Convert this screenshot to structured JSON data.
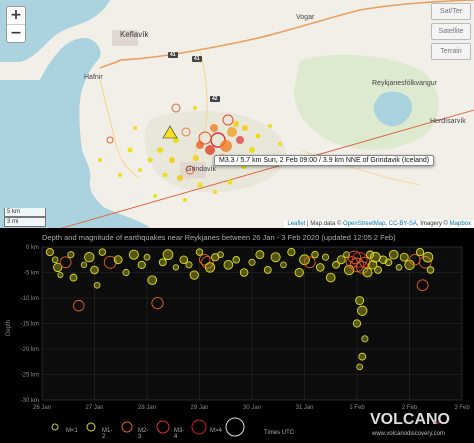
{
  "map": {
    "zoom_in": "+",
    "zoom_out": "−",
    "layer_buttons": [
      "Sat/Ter",
      "Satellite",
      "Terrain"
    ],
    "scale_km": "5 km",
    "scale_mi": "3 mi",
    "tooltip": "M3.3 / 5.7 km Sun, 2 Feb 09:00 / 3.9 km NNE of Grindavik (Iceland)",
    "attribution": {
      "leaflet": "Leaflet",
      "sep1": " | Map data © ",
      "osm": "OpenStreetMap",
      "sep2": ", ",
      "license": "CC-BY-SA",
      "sep3": ", Imagery © ",
      "mapbox": "Mapbox"
    },
    "places": {
      "keflavik": "Keflavík",
      "hafnir": "Hafnir",
      "grindavik": "Grindavík",
      "reykjavik_region": "Reykjanesfólkvangur",
      "herdisarvik": "Herdísarvík",
      "vogar": "Vogar"
    },
    "road_numbers": [
      "41",
      "41",
      "42"
    ]
  },
  "chart": {
    "title": "Depth and magnitude of earthquakes near Reykjanes between 26 Jan - 3 Feb 2020 (updated 12:05 2 Feb)",
    "legend": [
      {
        "label": "M<1",
        "color": "#cccc33"
      },
      {
        "label": "M1-2",
        "color": "#dddd22"
      },
      {
        "label": "M2-3",
        "color": "#e06020"
      },
      {
        "label": "M3-4",
        "color": "#e03030"
      },
      {
        "label": "M>4",
        "color": "#cc2222"
      },
      {
        "label": "",
        "color": "#dddddd"
      }
    ],
    "times_label": "Times UTC",
    "logo_main": "VOLCANO",
    "logo_sub": "www.volcanodiscovery.com",
    "logo_ornament": "~"
  },
  "chart_data": {
    "type": "scatter",
    "title": "Depth and magnitude of earthquakes near Reykjanes between 26 Jan - 3 Feb 2020 (updated 12:05 2 Feb)",
    "ylabel": "Depth",
    "ylim": [
      -30,
      0
    ],
    "y_ticks": [
      "0 km",
      "-5 km",
      "-10 km",
      "-15 km",
      "-20 km",
      "-25 km",
      "-30 km"
    ],
    "x_ticks": [
      "26 Jan",
      "27 Jan",
      "28 Jan",
      "29 Jan",
      "30 Jan",
      "31 Jan",
      "1 Feb",
      "2 Feb",
      "3 Feb"
    ],
    "xlim": [
      0,
      8
    ],
    "y_tick_values": [
      0,
      -5,
      -10,
      -15,
      -20,
      -25,
      -30
    ],
    "x_tick_values": [
      0,
      1,
      2,
      3,
      4,
      5,
      6,
      7,
      8
    ],
    "colors": {
      "M<1": "#cccc33",
      "M1-2": "#dddd22",
      "M2-3": "#e06020",
      "M3-4": "#e03030"
    },
    "points": [
      {
        "day": 0.15,
        "depth": -1.0,
        "mag": 1.2
      },
      {
        "day": 0.25,
        "depth": -2.5,
        "mag": 0.8
      },
      {
        "day": 0.3,
        "depth": -4.0,
        "mag": 1.5
      },
      {
        "day": 0.35,
        "depth": -5.5,
        "mag": 0.6
      },
      {
        "day": 0.45,
        "depth": -3.0,
        "mag": 2.2
      },
      {
        "day": 0.55,
        "depth": -1.5,
        "mag": 0.9
      },
      {
        "day": 0.6,
        "depth": -6.0,
        "mag": 1.1
      },
      {
        "day": 0.7,
        "depth": -11.5,
        "mag": 2.1
      },
      {
        "day": 0.8,
        "depth": -3.5,
        "mag": 0.7
      },
      {
        "day": 0.9,
        "depth": -2.0,
        "mag": 1.8
      },
      {
        "day": 1.0,
        "depth": -4.5,
        "mag": 1.3
      },
      {
        "day": 1.05,
        "depth": -7.5,
        "mag": 0.8
      },
      {
        "day": 1.15,
        "depth": -1.0,
        "mag": 1.0
      },
      {
        "day": 1.3,
        "depth": -3.0,
        "mag": 2.5
      },
      {
        "day": 1.45,
        "depth": -2.5,
        "mag": 1.4
      },
      {
        "day": 1.6,
        "depth": -5.0,
        "mag": 0.9
      },
      {
        "day": 1.75,
        "depth": -1.5,
        "mag": 1.7
      },
      {
        "day": 1.9,
        "depth": -3.5,
        "mag": 1.2
      },
      {
        "day": 2.0,
        "depth": -2.0,
        "mag": 0.8
      },
      {
        "day": 2.1,
        "depth": -6.5,
        "mag": 1.6
      },
      {
        "day": 2.2,
        "depth": -11.0,
        "mag": 2.3
      },
      {
        "day": 2.3,
        "depth": -3.0,
        "mag": 1.1
      },
      {
        "day": 2.4,
        "depth": -1.5,
        "mag": 1.9
      },
      {
        "day": 2.55,
        "depth": -4.0,
        "mag": 0.7
      },
      {
        "day": 2.7,
        "depth": -2.5,
        "mag": 1.3
      },
      {
        "day": 2.8,
        "depth": -3.5,
        "mag": 0.9
      },
      {
        "day": 2.9,
        "depth": -5.5,
        "mag": 1.5
      },
      {
        "day": 3.0,
        "depth": -1.0,
        "mag": 1.0
      },
      {
        "day": 3.1,
        "depth": -2.5,
        "mag": 2.1
      },
      {
        "day": 3.15,
        "depth": -3.0,
        "mag": 2.4
      },
      {
        "day": 3.2,
        "depth": -4.0,
        "mag": 1.8
      },
      {
        "day": 3.3,
        "depth": -2.0,
        "mag": 1.2
      },
      {
        "day": 3.4,
        "depth": -1.5,
        "mag": 0.8
      },
      {
        "day": 3.55,
        "depth": -3.5,
        "mag": 1.6
      },
      {
        "day": 3.7,
        "depth": -2.5,
        "mag": 1.0
      },
      {
        "day": 3.85,
        "depth": -5.0,
        "mag": 1.3
      },
      {
        "day": 4.0,
        "depth": -3.0,
        "mag": 0.9
      },
      {
        "day": 4.15,
        "depth": -1.5,
        "mag": 1.4
      },
      {
        "day": 4.3,
        "depth": -4.5,
        "mag": 1.1
      },
      {
        "day": 4.45,
        "depth": -2.0,
        "mag": 1.7
      },
      {
        "day": 4.6,
        "depth": -3.5,
        "mag": 0.8
      },
      {
        "day": 4.75,
        "depth": -1.0,
        "mag": 1.2
      },
      {
        "day": 4.9,
        "depth": -5.0,
        "mag": 1.5
      },
      {
        "day": 5.0,
        "depth": -2.5,
        "mag": 1.9
      },
      {
        "day": 5.1,
        "depth": -3.0,
        "mag": 2.2
      },
      {
        "day": 5.2,
        "depth": -1.5,
        "mag": 1.0
      },
      {
        "day": 5.3,
        "depth": -4.0,
        "mag": 1.3
      },
      {
        "day": 5.4,
        "depth": -2.0,
        "mag": 0.9
      },
      {
        "day": 5.5,
        "depth": -6.0,
        "mag": 1.6
      },
      {
        "day": 5.6,
        "depth": -3.5,
        "mag": 1.1
      },
      {
        "day": 5.7,
        "depth": -2.5,
        "mag": 1.4
      },
      {
        "day": 5.8,
        "depth": -1.5,
        "mag": 0.8
      },
      {
        "day": 5.85,
        "depth": -4.5,
        "mag": 1.8
      },
      {
        "day": 5.9,
        "depth": -3.0,
        "mag": 2.3
      },
      {
        "day": 5.95,
        "depth": -2.0,
        "mag": 2.6
      },
      {
        "day": 6.0,
        "depth": -3.5,
        "mag": 2.9
      },
      {
        "day": 6.05,
        "depth": -2.5,
        "mag": 3.3
      },
      {
        "day": 6.1,
        "depth": -4.0,
        "mag": 2.4
      },
      {
        "day": 6.15,
        "depth": -3.0,
        "mag": 2.0
      },
      {
        "day": 6.2,
        "depth": -5.0,
        "mag": 1.7
      },
      {
        "day": 6.25,
        "depth": -1.5,
        "mag": 1.2
      },
      {
        "day": 6.3,
        "depth": -3.5,
        "mag": 1.5
      },
      {
        "day": 6.35,
        "depth": -2.0,
        "mag": 1.9
      },
      {
        "day": 6.4,
        "depth": -4.5,
        "mag": 1.1
      },
      {
        "day": 6.05,
        "depth": -10.5,
        "mag": 1.4
      },
      {
        "day": 6.1,
        "depth": -12.5,
        "mag": 1.8
      },
      {
        "day": 6.0,
        "depth": -15.0,
        "mag": 1.2
      },
      {
        "day": 6.15,
        "depth": -18.0,
        "mag": 0.9
      },
      {
        "day": 6.1,
        "depth": -21.5,
        "mag": 1.1
      },
      {
        "day": 6.05,
        "depth": -23.5,
        "mag": 0.8
      },
      {
        "day": 6.5,
        "depth": -2.5,
        "mag": 1.3
      },
      {
        "day": 6.6,
        "depth": -3.0,
        "mag": 1.0
      },
      {
        "day": 6.7,
        "depth": -1.5,
        "mag": 1.6
      },
      {
        "day": 6.8,
        "depth": -4.0,
        "mag": 0.8
      },
      {
        "day": 6.9,
        "depth": -2.0,
        "mag": 1.4
      },
      {
        "day": 7.0,
        "depth": -3.5,
        "mag": 1.8
      },
      {
        "day": 7.1,
        "depth": -2.5,
        "mag": 2.1
      },
      {
        "day": 7.2,
        "depth": -1.0,
        "mag": 1.2
      },
      {
        "day": 7.3,
        "depth": -3.0,
        "mag": 2.4
      },
      {
        "day": 7.35,
        "depth": -2.0,
        "mag": 1.9
      },
      {
        "day": 7.25,
        "depth": -7.5,
        "mag": 2.2
      },
      {
        "day": 7.4,
        "depth": -4.5,
        "mag": 1.0
      }
    ]
  }
}
